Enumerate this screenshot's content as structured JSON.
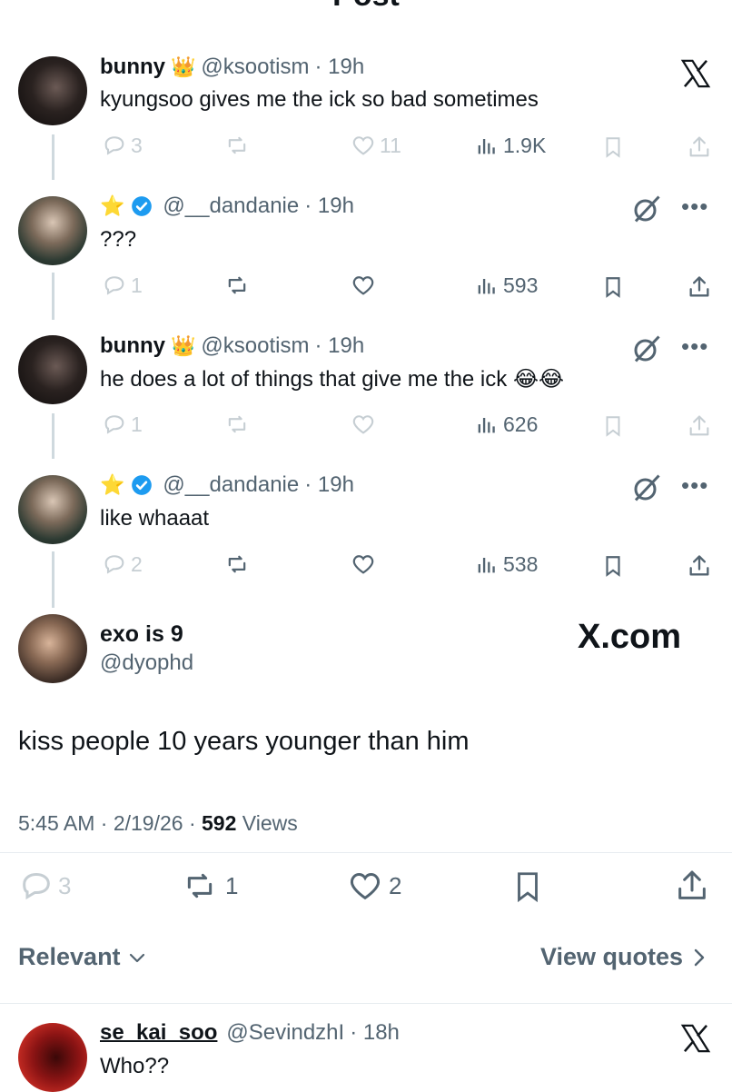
{
  "header": {
    "title": "Post"
  },
  "thread": [
    {
      "name": "bunny",
      "handle": "@ksootism",
      "time": "· 19h",
      "text": "kyungsoo gives me the ick so bad sometimes",
      "replies": "3",
      "reposts": "",
      "likes": "11",
      "views": "1.9K"
    },
    {
      "name": "",
      "handle": "@__dandanie",
      "time": "· 19h",
      "text": "???",
      "replies": "1",
      "reposts": "",
      "likes": "",
      "views": "593"
    },
    {
      "name": "bunny",
      "handle": "@ksootism",
      "time": "· 19h",
      "text": "he does a lot of things that give me the ick",
      "emoji": "😂😂",
      "replies": "1",
      "reposts": "",
      "likes": "",
      "views": "626"
    },
    {
      "name": "",
      "handle": "@__dandanie",
      "time": "· 19h",
      "text": "like whaaat",
      "replies": "2",
      "reposts": "",
      "likes": "",
      "views": "538"
    }
  ],
  "main_post": {
    "name": "exo is 9",
    "handle": "@dyophd",
    "text": "kiss people 10 years younger than him",
    "time": "5:45 AM · 2/19/26 ·",
    "views_count": "592",
    "views_label": "Views",
    "replies": "3",
    "reposts": "1",
    "likes": "2",
    "watermark": "X.com"
  },
  "sort": {
    "label": "Relevant",
    "view_quotes": "View quotes"
  },
  "reply": {
    "name": "se_kai_soo",
    "handle": "@SevindzhI",
    "time": "· 18h",
    "text": "Who??"
  },
  "colors": {
    "verified": "#1d9bf0",
    "text_secondary": "#536471",
    "dim_icon": "#c6ced3"
  }
}
